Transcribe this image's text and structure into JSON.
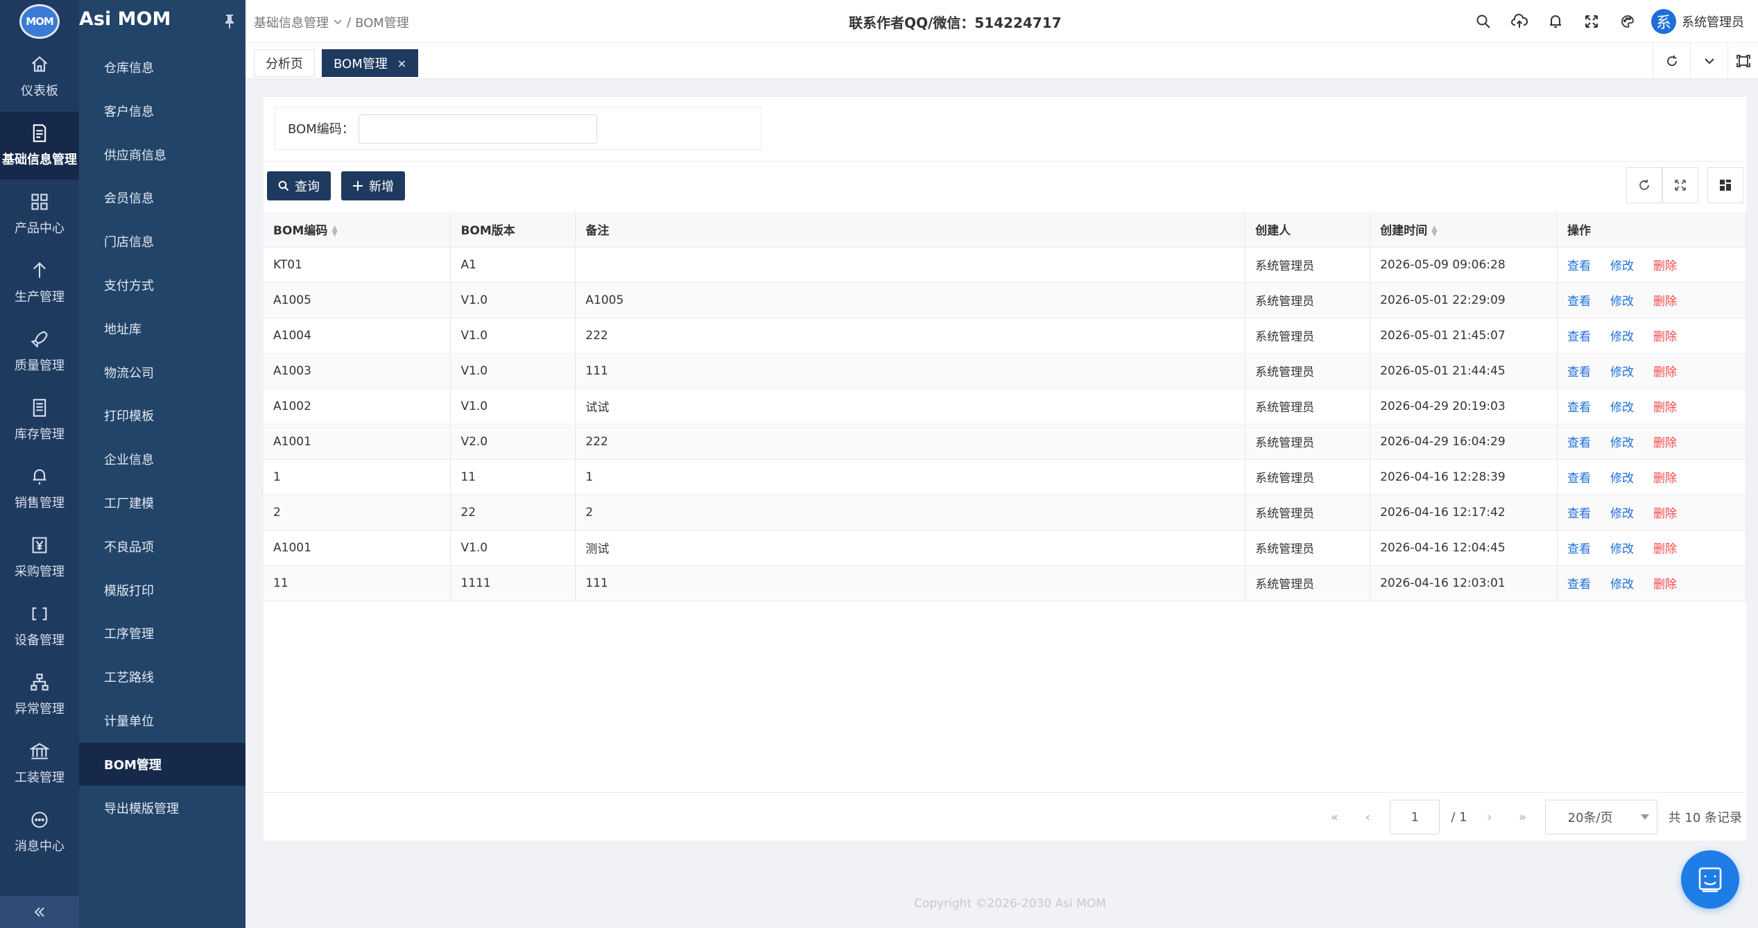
{
  "app": {
    "logo_text": "MOM",
    "name": "Asi MOM"
  },
  "rail": [
    {
      "label": "仪表板",
      "icon": "home-icon"
    },
    {
      "label": "基础信息管理",
      "icon": "document-icon",
      "active": true
    },
    {
      "label": "产品中心",
      "icon": "grid-icon"
    },
    {
      "label": "生产管理",
      "icon": "arrow-up-icon"
    },
    {
      "label": "质量管理",
      "icon": "rocket-icon"
    },
    {
      "label": "库存管理",
      "icon": "list-document-icon"
    },
    {
      "label": "销售管理",
      "icon": "bell-pin-icon"
    },
    {
      "label": "采购管理",
      "icon": "yen-icon"
    },
    {
      "label": "设备管理",
      "icon": "device-icon"
    },
    {
      "label": "异常管理",
      "icon": "hierarchy-icon"
    },
    {
      "label": "工装管理",
      "icon": "bank-icon"
    },
    {
      "label": "消息中心",
      "icon": "chat-icon"
    }
  ],
  "submenu": [
    {
      "label": "仓库信息"
    },
    {
      "label": "客户信息"
    },
    {
      "label": "供应商信息"
    },
    {
      "label": "会员信息"
    },
    {
      "label": "门店信息"
    },
    {
      "label": "支付方式"
    },
    {
      "label": "地址库"
    },
    {
      "label": "物流公司"
    },
    {
      "label": "打印模板"
    },
    {
      "label": "企业信息"
    },
    {
      "label": "工厂建模"
    },
    {
      "label": "不良品项"
    },
    {
      "label": "模版打印"
    },
    {
      "label": "工序管理"
    },
    {
      "label": "工艺路线"
    },
    {
      "label": "计量单位"
    },
    {
      "label": "BOM管理",
      "active": true
    },
    {
      "label": "导出模版管理"
    }
  ],
  "header": {
    "breadcrumb_parent": "基础信息管理",
    "breadcrumb_sep": "/",
    "breadcrumb_current": "BOM管理",
    "contact": "联系作者QQ/微信：514224717",
    "user_avatar": "系",
    "user_name": "系统管理员"
  },
  "tabs": [
    {
      "label": "分析页"
    },
    {
      "label": "BOM管理",
      "active": true,
      "close": "×"
    }
  ],
  "search": {
    "label": "BOM编码：",
    "value": "",
    "placeholder": ""
  },
  "toolbar": {
    "query_label": "查询",
    "add_label": "新增"
  },
  "table": {
    "columns": [
      "BOM编码",
      "BOM版本",
      "备注",
      "创建人",
      "创建时间",
      "操作"
    ],
    "actions": {
      "view": "查看",
      "edit": "修改",
      "delete": "删除"
    },
    "rows": [
      {
        "code": "KT01",
        "version": "A1",
        "remark": "",
        "creator": "系统管理员",
        "created": "2026-05-09 09:06:28"
      },
      {
        "code": "A1005",
        "version": "V1.0",
        "remark": "A1005",
        "creator": "系统管理员",
        "created": "2026-05-01 22:29:09"
      },
      {
        "code": "A1004",
        "version": "V1.0",
        "remark": "222",
        "creator": "系统管理员",
        "created": "2026-05-01 21:45:07"
      },
      {
        "code": "A1003",
        "version": "V1.0",
        "remark": "111",
        "creator": "系统管理员",
        "created": "2026-05-01 21:44:45"
      },
      {
        "code": "A1002",
        "version": "V1.0",
        "remark": "试试",
        "creator": "系统管理员",
        "created": "2026-04-29 20:19:03"
      },
      {
        "code": "A1001",
        "version": "V2.0",
        "remark": "222",
        "creator": "系统管理员",
        "created": "2026-04-29 16:04:29"
      },
      {
        "code": "1",
        "version": "11",
        "remark": "1",
        "creator": "系统管理员",
        "created": "2026-04-16 12:28:39"
      },
      {
        "code": "2",
        "version": "22",
        "remark": "2",
        "creator": "系统管理员",
        "created": "2026-04-16 12:17:42"
      },
      {
        "code": "A1001",
        "version": "V1.0",
        "remark": "测试",
        "creator": "系统管理员",
        "created": "2026-04-16 12:04:45"
      },
      {
        "code": "11",
        "version": "1111",
        "remark": "111",
        "creator": "系统管理员",
        "created": "2026-04-16 12:03:01"
      }
    ]
  },
  "pager": {
    "page": "1",
    "total_pages": "/ 1",
    "page_size": "20条/页",
    "total": "共 10 条记录"
  },
  "footer": "Copyright ©2026-2030 Asi MOM",
  "colors": {
    "sidebar": "#1f3a5f",
    "accent": "#1e6fd9",
    "danger": "#f5484a"
  }
}
